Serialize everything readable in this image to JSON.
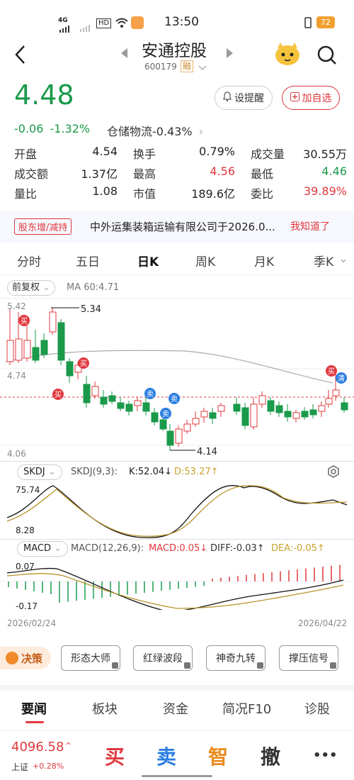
{
  "status": {
    "time": "13:50",
    "network": "4G",
    "hd": "HD",
    "battery": "72"
  },
  "header": {
    "name": "安通控股",
    "code": "600179",
    "tag": "融"
  },
  "price": {
    "last": "4.48",
    "change": "-0.06",
    "pct": "-1.32%",
    "sector": "仓储物流",
    "sector_pct": "-0.43%",
    "alert_label": "设提醒",
    "watch_label": "加自选"
  },
  "quote": [
    [
      {
        "k": "开盘",
        "v": "4.54",
        "c": "n"
      },
      {
        "k": "换手",
        "v": "0.79%",
        "c": "n"
      },
      {
        "k": "成交量",
        "v": "30.55万",
        "c": "n"
      }
    ],
    [
      {
        "k": "成交额",
        "v": "1.37亿",
        "c": "n"
      },
      {
        "k": "最高",
        "v": "4.56",
        "c": "r"
      },
      {
        "k": "最低",
        "v": "4.46",
        "c": "g"
      }
    ],
    [
      {
        "k": "量比",
        "v": "1.08",
        "c": "n"
      },
      {
        "k": "市值",
        "v": "189.6亿",
        "c": "n"
      },
      {
        "k": "委比",
        "v": "39.89%",
        "c": "r"
      }
    ]
  ],
  "notice": {
    "tag": "股东增/减持",
    "text": "中外运集装箱运输有限公司于2026.0...",
    "ack": "我知道了"
  },
  "periods": [
    "分时",
    "五日",
    "日K",
    "周K",
    "月K",
    "季K"
  ],
  "active_period": "日K",
  "kline": {
    "adjust": "前复权",
    "ma_label": "MA 60:4.71",
    "ymax": "5.42",
    "ymid": "4.74",
    "ymin": "4.06",
    "hi_label": "5.34",
    "lo_label": "4.14",
    "buy": "买",
    "sell": "卖",
    "clear": "清"
  },
  "skdj": {
    "name": "SKDJ",
    "params": "SKDJ(9,3):",
    "k": "K:52.04↓",
    "d": "D:53.27↑",
    "top": "75.74",
    "bot": "8.28"
  },
  "macd": {
    "name": "MACD",
    "params": "MACD(12,26,9):",
    "macd": "MACD:0.05↓",
    "diff": "DIFF:-0.03↑",
    "dea": "DEA:-0.05↑",
    "top": "0.07",
    "bot": "-0.17"
  },
  "dates": {
    "start": "2026/02/24",
    "end": "2026/04/22"
  },
  "decision": {
    "label": "决策",
    "chips": [
      "形态大师",
      "红绿波段",
      "神奇九转",
      "撑压信号"
    ]
  },
  "bottom_tabs": [
    "要闻",
    "板块",
    "资金",
    "简况F10",
    "诊股"
  ],
  "index": {
    "value": "4096.58",
    "name": "上证",
    "pct": "+0.28%"
  },
  "actions": {
    "buy": "买",
    "sell": "卖",
    "smart": "智",
    "cancel": "撤",
    "more": "•••"
  },
  "colors": {
    "up": "#e0383e",
    "down": "#1a9a4a",
    "blue": "#2a7de1",
    "orange": "#e98b1e"
  }
}
